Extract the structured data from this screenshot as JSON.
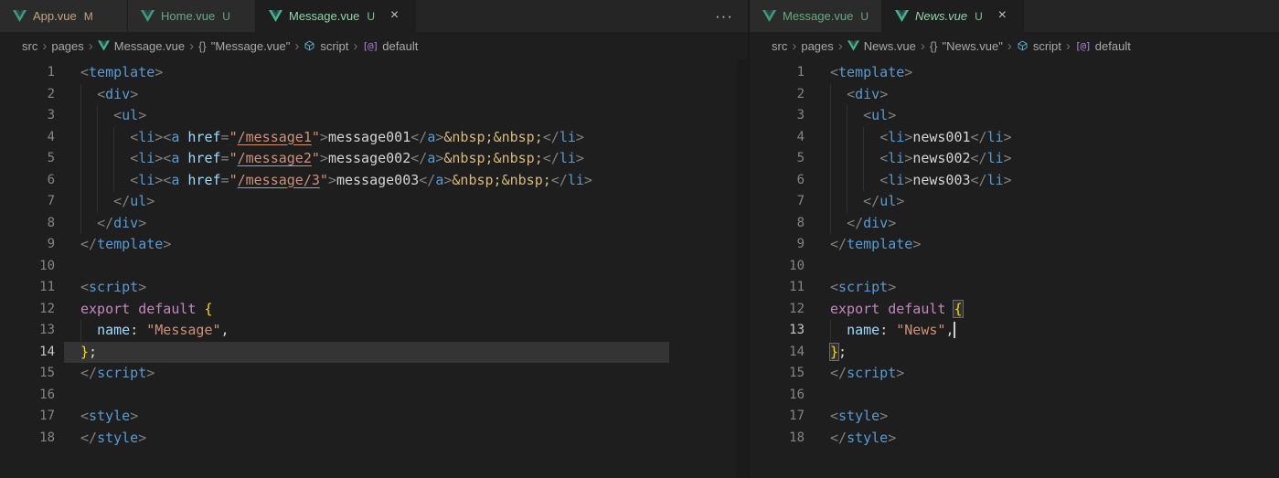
{
  "theme": {
    "editor_bg": "#1e1e1e",
    "tabbar_bg": "#252526",
    "tab_inactive_bg": "#2d2d2d",
    "tab_active_bg": "#1e1e1e",
    "untracked_color": "#73c991",
    "modified_color": "#e2c08d",
    "vue_brand_color": "#41b883",
    "close_glyph": "×",
    "crumb_separator": "›"
  },
  "groups": [
    {
      "name": "left",
      "tabs": [
        {
          "label": "App.vue",
          "icon": "vue",
          "badge": "M",
          "badge_color": "#e2c08d",
          "label_color": "#e2c08d",
          "active": false,
          "closable": false,
          "italic": false
        },
        {
          "label": "Home.vue",
          "icon": "vue",
          "badge": "U",
          "badge_color": "#73c991",
          "label_color": "#73c991",
          "active": false,
          "closable": false,
          "italic": false
        },
        {
          "label": "Message.vue",
          "icon": "vue",
          "badge": "U",
          "badge_color": "#73c991",
          "label_color": "#8fd5a8",
          "active": true,
          "closable": true,
          "italic": false
        }
      ],
      "more_actions": "···",
      "breadcrumb": [
        {
          "label": "src"
        },
        {
          "label": "pages"
        },
        {
          "label": "Message.vue",
          "icon": "vue"
        },
        {
          "label": "\"Message.vue\"",
          "icon": "braces"
        },
        {
          "label": "script",
          "icon": "module"
        },
        {
          "label": "default",
          "icon": "default"
        }
      ],
      "minimap": true,
      "code": {
        "lines": [
          {
            "n": "1",
            "tokens": [
              [
                "p",
                "<"
              ],
              [
                "t",
                "template"
              ],
              [
                "p",
                ">"
              ]
            ]
          },
          {
            "n": "2",
            "tokens": [
              [
                "w",
                "  "
              ],
              [
                "p",
                "<"
              ],
              [
                "t",
                "div"
              ],
              [
                "p",
                ">"
              ]
            ]
          },
          {
            "n": "3",
            "tokens": [
              [
                "w",
                "    "
              ],
              [
                "p",
                "<"
              ],
              [
                "t",
                "ul"
              ],
              [
                "p",
                ">"
              ]
            ]
          },
          {
            "n": "4",
            "tokens": [
              [
                "w",
                "      "
              ],
              [
                "p",
                "<"
              ],
              [
                "t",
                "li"
              ],
              [
                "p",
                "><"
              ],
              [
                "t",
                "a"
              ],
              [
                "w",
                " "
              ],
              [
                "a",
                "href"
              ],
              [
                "p",
                "="
              ],
              [
                "s",
                "\""
              ],
              [
                "sl",
                "/message1"
              ],
              [
                "s",
                "\""
              ],
              [
                "p",
                ">"
              ],
              [
                "x",
                "message001"
              ],
              [
                "p",
                "</"
              ],
              [
                "t",
                "a"
              ],
              [
                "p",
                ">"
              ],
              [
                "e",
                "&nbsp;&nbsp;"
              ],
              [
                "p",
                "</"
              ],
              [
                "t",
                "li"
              ],
              [
                "p",
                ">"
              ]
            ]
          },
          {
            "n": "5",
            "tokens": [
              [
                "w",
                "      "
              ],
              [
                "p",
                "<"
              ],
              [
                "t",
                "li"
              ],
              [
                "p",
                "><"
              ],
              [
                "t",
                "a"
              ],
              [
                "w",
                " "
              ],
              [
                "a",
                "href"
              ],
              [
                "p",
                "="
              ],
              [
                "s",
                "\""
              ],
              [
                "sl",
                "/message2"
              ],
              [
                "s",
                "\""
              ],
              [
                "p",
                ">"
              ],
              [
                "x",
                "message002"
              ],
              [
                "p",
                "</"
              ],
              [
                "t",
                "a"
              ],
              [
                "p",
                ">"
              ],
              [
                "e",
                "&nbsp;&nbsp;"
              ],
              [
                "p",
                "</"
              ],
              [
                "t",
                "li"
              ],
              [
                "p",
                ">"
              ]
            ]
          },
          {
            "n": "6",
            "tokens": [
              [
                "w",
                "      "
              ],
              [
                "p",
                "<"
              ],
              [
                "t",
                "li"
              ],
              [
                "p",
                "><"
              ],
              [
                "t",
                "a"
              ],
              [
                "w",
                " "
              ],
              [
                "a",
                "href"
              ],
              [
                "p",
                "="
              ],
              [
                "s",
                "\""
              ],
              [
                "sl",
                "/message/3"
              ],
              [
                "s",
                "\""
              ],
              [
                "p",
                ">"
              ],
              [
                "x",
                "message003"
              ],
              [
                "p",
                "</"
              ],
              [
                "t",
                "a"
              ],
              [
                "p",
                ">"
              ],
              [
                "e",
                "&nbsp;&nbsp;"
              ],
              [
                "p",
                "</"
              ],
              [
                "t",
                "li"
              ],
              [
                "p",
                ">"
              ]
            ]
          },
          {
            "n": "7",
            "tokens": [
              [
                "w",
                "    "
              ],
              [
                "p",
                "</"
              ],
              [
                "t",
                "ul"
              ],
              [
                "p",
                ">"
              ]
            ]
          },
          {
            "n": "8",
            "tokens": [
              [
                "w",
                "  "
              ],
              [
                "p",
                "</"
              ],
              [
                "t",
                "div"
              ],
              [
                "p",
                ">"
              ]
            ]
          },
          {
            "n": "9",
            "tokens": [
              [
                "p",
                "</"
              ],
              [
                "t",
                "template"
              ],
              [
                "p",
                ">"
              ]
            ]
          },
          {
            "n": "10",
            "tokens": []
          },
          {
            "n": "11",
            "tokens": [
              [
                "p",
                "<"
              ],
              [
                "t",
                "script"
              ],
              [
                "p",
                ">"
              ]
            ]
          },
          {
            "n": "12",
            "tokens": [
              [
                "k",
                "export"
              ],
              [
                "w",
                " "
              ],
              [
                "k",
                "default"
              ],
              [
                "w",
                " "
              ],
              [
                "b",
                "{"
              ]
            ]
          },
          {
            "n": "13",
            "tokens": [
              [
                "w",
                "  "
              ],
              [
                "a",
                "name"
              ],
              [
                "w",
                ": "
              ],
              [
                "s",
                "\"Message\""
              ],
              [
                "w",
                ","
              ]
            ]
          },
          {
            "n": "14",
            "highlight": true,
            "active_ln": true,
            "tokens": [
              [
                "b",
                "}"
              ],
              [
                "w",
                ";"
              ]
            ]
          },
          {
            "n": "15",
            "tokens": [
              [
                "p",
                "</"
              ],
              [
                "t",
                "script"
              ],
              [
                "p",
                ">"
              ]
            ]
          },
          {
            "n": "16",
            "tokens": []
          },
          {
            "n": "17",
            "tokens": [
              [
                "p",
                "<"
              ],
              [
                "t",
                "style"
              ],
              [
                "p",
                ">"
              ]
            ]
          },
          {
            "n": "18",
            "tokens": [
              [
                "p",
                "</"
              ],
              [
                "t",
                "style"
              ],
              [
                "p",
                ">"
              ]
            ]
          }
        ]
      }
    },
    {
      "name": "right",
      "tabs": [
        {
          "label": "Message.vue",
          "icon": "vue",
          "badge": "U",
          "badge_color": "#73c991",
          "label_color": "#73c991",
          "active": false,
          "closable": false,
          "italic": false
        },
        {
          "label": "News.vue",
          "icon": "vue",
          "badge": "U",
          "badge_color": "#73c991",
          "label_color": "#8fd5a8",
          "active": true,
          "closable": true,
          "italic": true
        }
      ],
      "more_actions": null,
      "breadcrumb": [
        {
          "label": "src"
        },
        {
          "label": "pages"
        },
        {
          "label": "News.vue",
          "icon": "vue"
        },
        {
          "label": "\"News.vue\"",
          "icon": "braces"
        },
        {
          "label": "script",
          "icon": "module"
        },
        {
          "label": "default",
          "icon": "default"
        }
      ],
      "minimap": false,
      "code": {
        "lines": [
          {
            "n": "1",
            "tokens": [
              [
                "p",
                "<"
              ],
              [
                "t",
                "template"
              ],
              [
                "p",
                ">"
              ]
            ]
          },
          {
            "n": "2",
            "tokens": [
              [
                "w",
                "  "
              ],
              [
                "p",
                "<"
              ],
              [
                "t",
                "div"
              ],
              [
                "p",
                ">"
              ]
            ]
          },
          {
            "n": "3",
            "tokens": [
              [
                "w",
                "    "
              ],
              [
                "p",
                "<"
              ],
              [
                "t",
                "ul"
              ],
              [
                "p",
                ">"
              ]
            ]
          },
          {
            "n": "4",
            "tokens": [
              [
                "w",
                "      "
              ],
              [
                "p",
                "<"
              ],
              [
                "t",
                "li"
              ],
              [
                "p",
                ">"
              ],
              [
                "x",
                "news001"
              ],
              [
                "p",
                "</"
              ],
              [
                "t",
                "li"
              ],
              [
                "p",
                ">"
              ]
            ]
          },
          {
            "n": "5",
            "tokens": [
              [
                "w",
                "      "
              ],
              [
                "p",
                "<"
              ],
              [
                "t",
                "li"
              ],
              [
                "p",
                ">"
              ],
              [
                "x",
                "news002"
              ],
              [
                "p",
                "</"
              ],
              [
                "t",
                "li"
              ],
              [
                "p",
                ">"
              ]
            ]
          },
          {
            "n": "6",
            "tokens": [
              [
                "w",
                "      "
              ],
              [
                "p",
                "<"
              ],
              [
                "t",
                "li"
              ],
              [
                "p",
                ">"
              ],
              [
                "x",
                "news003"
              ],
              [
                "p",
                "</"
              ],
              [
                "t",
                "li"
              ],
              [
                "p",
                ">"
              ]
            ]
          },
          {
            "n": "7",
            "tokens": [
              [
                "w",
                "    "
              ],
              [
                "p",
                "</"
              ],
              [
                "t",
                "ul"
              ],
              [
                "p",
                ">"
              ]
            ]
          },
          {
            "n": "8",
            "tokens": [
              [
                "w",
                "  "
              ],
              [
                "p",
                "</"
              ],
              [
                "t",
                "div"
              ],
              [
                "p",
                ">"
              ]
            ]
          },
          {
            "n": "9",
            "tokens": [
              [
                "p",
                "</"
              ],
              [
                "t",
                "template"
              ],
              [
                "p",
                ">"
              ]
            ]
          },
          {
            "n": "10",
            "tokens": []
          },
          {
            "n": "11",
            "tokens": [
              [
                "p",
                "<"
              ],
              [
                "t",
                "script"
              ],
              [
                "p",
                ">"
              ]
            ]
          },
          {
            "n": "12",
            "tokens": [
              [
                "k",
                "export"
              ],
              [
                "w",
                " "
              ],
              [
                "k",
                "default"
              ],
              [
                "w",
                " "
              ],
              [
                "bm",
                "{"
              ]
            ]
          },
          {
            "n": "13",
            "active_ln": true,
            "tokens": [
              [
                "w",
                "  "
              ],
              [
                "a",
                "name"
              ],
              [
                "w",
                ": "
              ],
              [
                "s",
                "\"News\""
              ],
              [
                "w",
                ","
              ],
              [
                "cur",
                ""
              ]
            ]
          },
          {
            "n": "14",
            "tokens": [
              [
                "bm",
                "}"
              ],
              [
                "w",
                ";"
              ]
            ]
          },
          {
            "n": "15",
            "tokens": [
              [
                "p",
                "</"
              ],
              [
                "t",
                "script"
              ],
              [
                "p",
                ">"
              ]
            ]
          },
          {
            "n": "16",
            "tokens": []
          },
          {
            "n": "17",
            "tokens": [
              [
                "p",
                "<"
              ],
              [
                "t",
                "style"
              ],
              [
                "p",
                ">"
              ]
            ]
          },
          {
            "n": "18",
            "tokens": [
              [
                "p",
                "</"
              ],
              [
                "t",
                "style"
              ],
              [
                "p",
                ">"
              ]
            ]
          }
        ]
      }
    }
  ]
}
